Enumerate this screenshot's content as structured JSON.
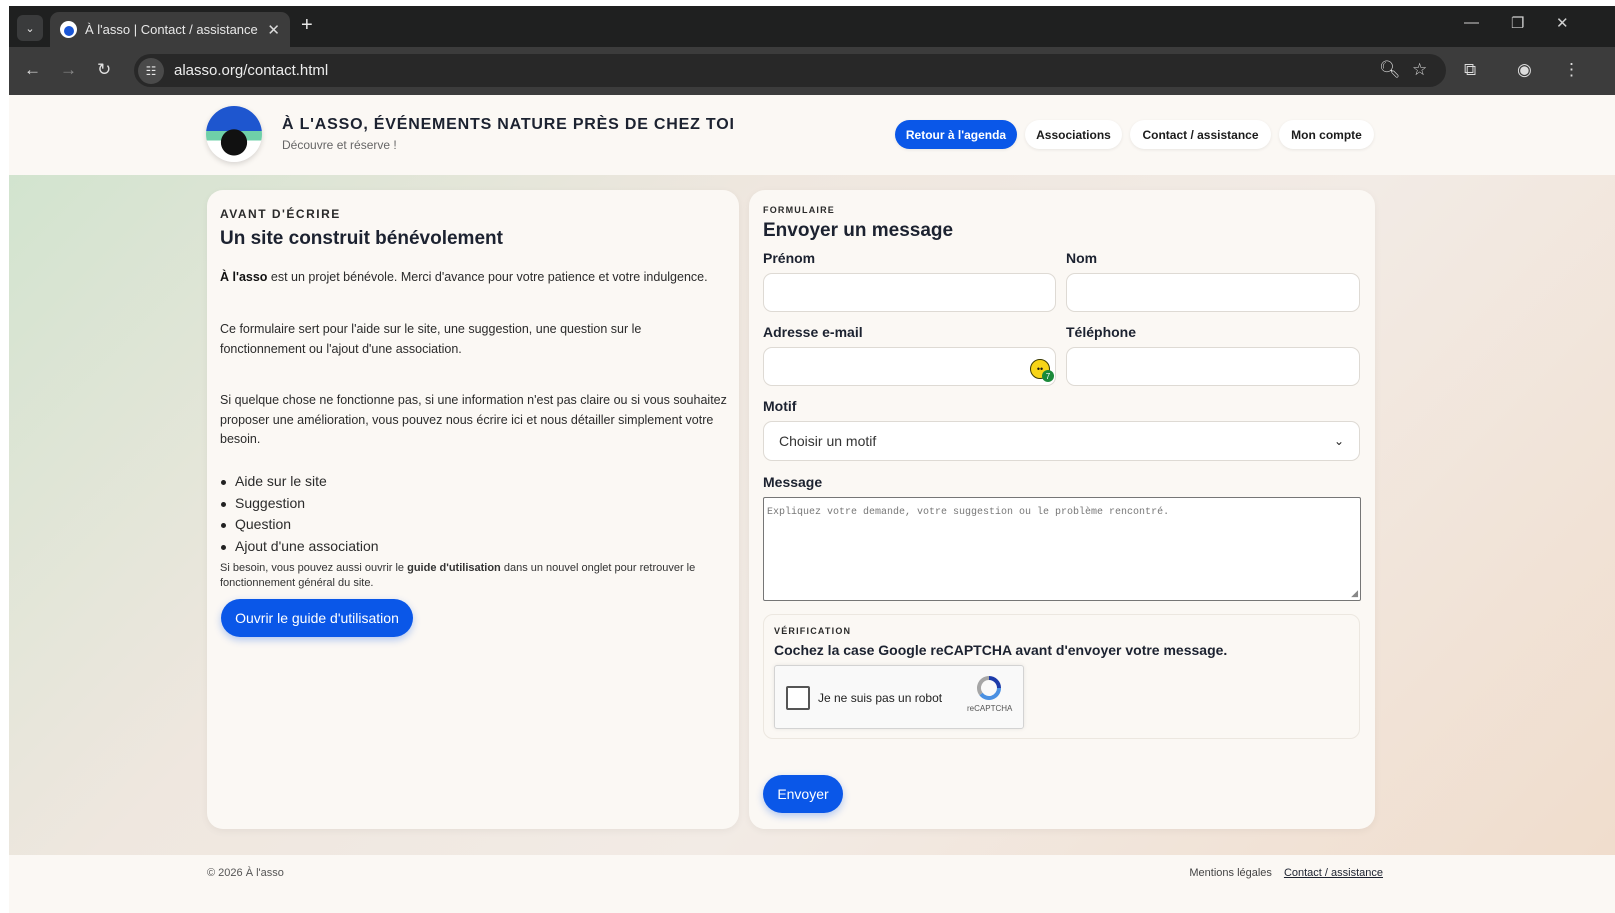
{
  "browser": {
    "tab_title": "À l'asso | Contact / assistance",
    "tab_close": "✕",
    "new_tab": "+",
    "url": "alasso.org/contact.html"
  },
  "header": {
    "title": "À L'ASSO, ÉVÉNEMENTS NATURE PRÈS DE CHEZ TOI",
    "subtitle": "Découvre et réserve !",
    "nav": [
      "Retour à l'agenda",
      "Associations",
      "Contact / assistance",
      "Mon compte"
    ]
  },
  "left": {
    "eyebrow": "AVANT D'ÉCRIRE",
    "heading": "Un site construit bénévolement",
    "p1_bold": "À l'asso",
    "p1_rest": " est un projet bénévole. Merci d'avance pour votre patience et votre indulgence.",
    "p2": "Ce formulaire sert pour l'aide sur le site, une suggestion, une question sur le fonctionnement ou l'ajout d'une association.",
    "p3": "Si quelque chose ne fonctionne pas, si une information n'est pas claire ou si vous souhaitez proposer une amélioration, vous pouvez nous écrire ici et nous détailler simplement votre besoin.",
    "list": [
      "Aide sur le site",
      "Suggestion",
      "Question",
      "Ajout d'une association"
    ],
    "small_pre": "Si besoin, vous pouvez aussi ouvrir le ",
    "small_bold": "guide d'utilisation",
    "small_post": " dans un nouvel onglet pour retrouver le fonctionnement général du site.",
    "guide_button": "Ouvrir le guide d'utilisation"
  },
  "form": {
    "eyebrow": "FORMULAIRE",
    "heading": "Envoyer un message",
    "prenom_label": "Prénom",
    "nom_label": "Nom",
    "email_label": "Adresse e-mail",
    "phone_label": "Téléphone",
    "email_badge_count": "7",
    "motif_label": "Motif",
    "motif_selected": "Choisir un motif",
    "message_label": "Message",
    "message_placeholder": "Expliquez votre demande, votre suggestion ou le problème rencontré.",
    "verif_eyebrow": "VÉRIFICATION",
    "verif_text": "Cochez la case Google reCAPTCHA avant d'envoyer votre message.",
    "captcha_label": "Je ne suis pas un robot",
    "captcha_brand": "reCAPTCHA",
    "submit": "Envoyer"
  },
  "footer": {
    "copyright": "© 2026 À l'asso",
    "links": [
      "Mentions légales",
      "Contact / assistance"
    ]
  },
  "colors": {
    "accent": "#0a57e8",
    "card": "#fbf8f4",
    "chrome_dark": "#1f2020"
  }
}
